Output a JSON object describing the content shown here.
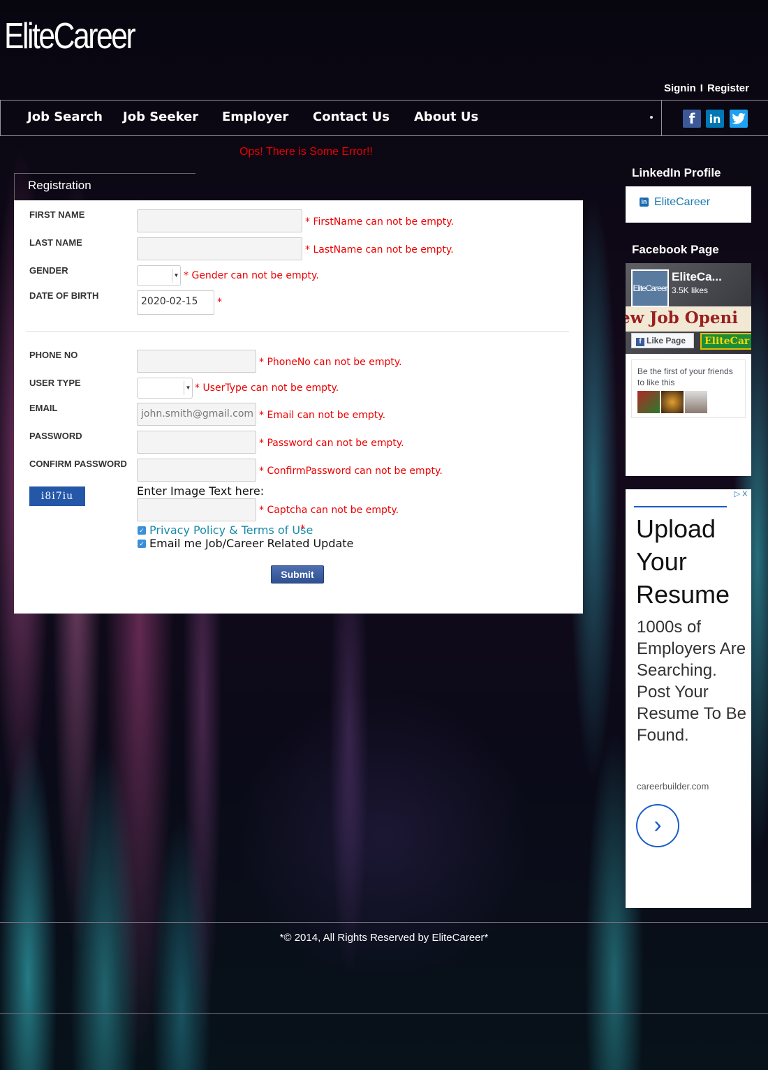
{
  "brand": {
    "logo_text": "EliteCareer"
  },
  "auth": {
    "signin": "Signin",
    "separator": "I",
    "register": "Register"
  },
  "nav": {
    "items": [
      {
        "label": "Job Search"
      },
      {
        "label": "Job Seeker"
      },
      {
        "label": "Employer"
      },
      {
        "label": "Contact Us"
      },
      {
        "label": "About Us"
      }
    ],
    "social": {
      "facebook": "f",
      "linkedin": "in",
      "twitter": "t"
    }
  },
  "error_banner": "Ops! There is Some Error!!",
  "registration": {
    "title": "Registration",
    "fields": {
      "first_name": {
        "label": "FIRST NAME",
        "value": "",
        "error": "* FirstName can not be empty."
      },
      "last_name": {
        "label": "LAST NAME",
        "value": "",
        "error": "* LastName can not be empty."
      },
      "gender": {
        "label": "GENDER",
        "value": "",
        "error": "* Gender can not be empty."
      },
      "dob": {
        "label": "DATE OF BIRTH",
        "value": "2020-02-15",
        "error": "*"
      },
      "phone": {
        "label": "PHONE NO",
        "value": "",
        "error": "* PhoneNo can not be empty."
      },
      "user_type": {
        "label": "USER TYPE",
        "value": "",
        "error": "* UserType can not be empty."
      },
      "email": {
        "label": "EMAIL",
        "value": "",
        "placeholder": "john.smith@gmail.com",
        "error": "* Email can not be empty."
      },
      "password": {
        "label": "PASSWORD",
        "value": "",
        "error": "* Password can not be empty."
      },
      "confirm_password": {
        "label": "CONFIRM PASSWORD",
        "value": "",
        "error": "* ConfirmPassword can not be empty."
      },
      "captcha": {
        "image_text": "i8i7iu",
        "label": "Enter Image Text here:",
        "value": "",
        "error": "* Captcha can not be empty."
      }
    },
    "checkboxes": {
      "privacy": {
        "label": "Privacy Policy & Terms of Use",
        "required_mark": "*",
        "checked": true
      },
      "updates": {
        "label": "Email me Job/Career Related Update",
        "checked": true
      }
    },
    "submit_label": "Submit"
  },
  "sidebar": {
    "linkedin": {
      "heading": "LinkedIn Profile",
      "link_text": "EliteCareer",
      "icon": "linkedin-icon"
    },
    "facebook": {
      "heading": "Facebook Page",
      "page_name": "EliteCa...",
      "likes": "3.5K likes",
      "avatar_text": "EliteCareer",
      "cover_banner": "ew Job Openi",
      "like_button": "Like Page",
      "logo_text": "EliteCar",
      "friends_text": "Be the first of your friends to like this"
    },
    "ad": {
      "adchoices": "▷ X",
      "headline": "Upload Your Resume",
      "body": "1000s of Employers Are Searching. Post Your Resume To Be Found.",
      "domain": "careerbuilder.com",
      "cta_icon": "chevron-right-icon"
    }
  },
  "footer": {
    "text": "*© 2014, All Rights Reserved by EliteCareer*"
  },
  "colors": {
    "error": "#ee0000",
    "link": "#1a7ab0",
    "submit": "#3b5a9a",
    "facebook": "#3b5998",
    "linkedin": "#0077b5",
    "twitter": "#1da1f2"
  }
}
